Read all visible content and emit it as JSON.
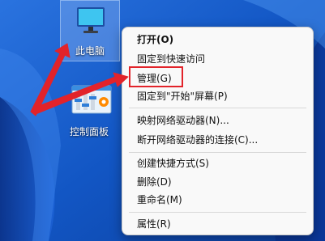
{
  "desktop": {
    "icons": [
      {
        "label": "此电脑"
      },
      {
        "label": "控制面板"
      }
    ]
  },
  "context_menu": {
    "items": [
      {
        "label": "打开(O)"
      },
      {
        "label": "固定到快速访问"
      },
      {
        "label": "管理(G)"
      },
      {
        "label": "固定到\"开始\"屏幕(P)"
      },
      {
        "label": "映射网络驱动器(N)..."
      },
      {
        "label": "断开网络驱动器的连接(C)..."
      },
      {
        "label": "创建快捷方式(S)"
      },
      {
        "label": "删除(D)"
      },
      {
        "label": "重命名(M)"
      },
      {
        "label": "属性(R)"
      }
    ]
  },
  "colors": {
    "annotation": "#e2232a",
    "wallpaper": "#1a66d6"
  }
}
